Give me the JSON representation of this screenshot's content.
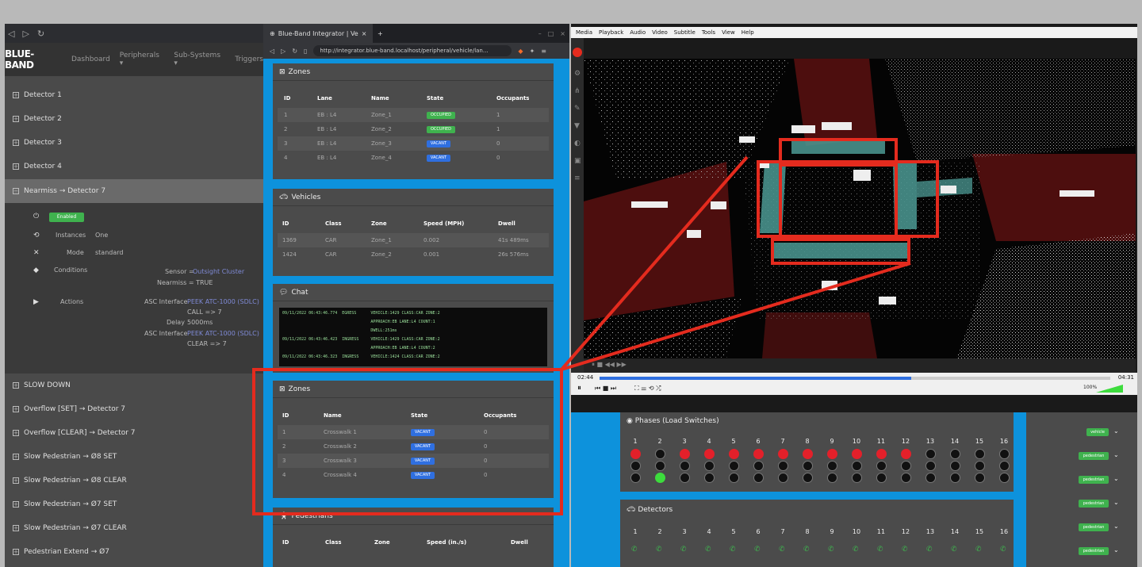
{
  "left": {
    "brand": "BLUE-BAND",
    "nav": [
      "Dashboard",
      "Peripherals ▾",
      "Sub-Systems ▾",
      "Triggers"
    ],
    "detectors_top": [
      "Detector 1",
      "Detector 2",
      "Detector 3",
      "Detector 4"
    ],
    "selected_item": "Nearmiss → Detector 7",
    "detail": {
      "enabled": "Enabled",
      "instances_label": "Instances",
      "instances_value": "One",
      "mode_label": "Mode",
      "mode_value": "standard",
      "conditions_label": "Conditions",
      "sensor_prefix": "Sensor =",
      "sensor_value": "Outsight Cluster",
      "nearmiss": "Nearmiss = TRUE",
      "actions_label": "Actions",
      "asc1_label": "ASC Interface",
      "asc1_value": "PEEK ATC-1000 (SDLC)",
      "call": "CALL => 7",
      "delay_label": "Delay",
      "delay_value": "5000ms",
      "asc2_label": "ASC Interface",
      "asc2_value": "PEEK ATC-1000 (SDLC)",
      "clear": "CLEAR => 7"
    },
    "detectors_bottom": [
      "SLOW DOWN",
      "Overflow [SET] → Detector 7",
      "Overflow [CLEAR] → Detector 7",
      "Slow Pedestrian → Ø8 SET",
      "Slow Pedestrian → Ø8 CLEAR",
      "Slow Pedestrian → Ø7 SET",
      "Slow Pedestrian → Ø7 CLEAR",
      "Pedestrian Extend → Ø7"
    ]
  },
  "mid": {
    "tab_title": "Blue-Band Integrator | Ve",
    "url": "http://integrator.blue-band.localhost/peripheral/vehicle/lan...",
    "zones": {
      "title": "Zones",
      "headers": [
        "ID",
        "Lane",
        "Name",
        "State",
        "Occupants"
      ],
      "rows": [
        [
          "1",
          "EB : L4",
          "Zone_1",
          "OCCUPIED",
          "1"
        ],
        [
          "2",
          "EB : L4",
          "Zone_2",
          "OCCUPIED",
          "1"
        ],
        [
          "3",
          "EB : L4",
          "Zone_3",
          "VACANT",
          "0"
        ],
        [
          "4",
          "EB : L4",
          "Zone_4",
          "VACANT",
          "0"
        ]
      ]
    },
    "vehicles": {
      "title": "Vehicles",
      "headers": [
        "ID",
        "Class",
        "Zone",
        "Speed (MPH)",
        "Dwell"
      ],
      "rows": [
        [
          "1369",
          "CAR",
          "Zone_1",
          "0.002",
          "41s 489ms"
        ],
        [
          "1424",
          "CAR",
          "Zone_2",
          "0.001",
          "26s 576ms"
        ]
      ]
    },
    "chat": {
      "title": "Chat",
      "lines": [
        "09/11/2022 06:43:46.774  EGRESS      VEHICLE:1429 CLASS:CAR ZONE:2",
        "                                     APPROACH:EB LANE:L4 COUNT:1",
        "                                     DWELL:251ms",
        "09/11/2022 06:43:46.423  INGRESS     VEHICLE:1429 CLASS:CAR ZONE:2",
        "                                     APPROACH:EB LANE:L4 COUNT:2",
        "09/11/2022 06:43:46.323  INGRESS     VEHICLE:1424 CLASS:CAR ZONE:2"
      ]
    },
    "crosswalks": {
      "title": "Zones",
      "headers": [
        "ID",
        "Name",
        "State",
        "Occupants"
      ],
      "rows": [
        [
          "1",
          "Crosswalk 1",
          "VACANT",
          "0"
        ],
        [
          "2",
          "Crosswalk 2",
          "VACANT",
          "0"
        ],
        [
          "3",
          "Crosswalk 3",
          "VACANT",
          "0"
        ],
        [
          "4",
          "Crosswalk 4",
          "VACANT",
          "0"
        ]
      ]
    },
    "pedestrians": {
      "title": "Pedestrians",
      "headers": [
        "ID",
        "Class",
        "Zone",
        "Speed (in./s)",
        "Dwell"
      ]
    }
  },
  "right": {
    "menu": [
      "Media",
      "Playback",
      "Audio",
      "Video",
      "Subtitle",
      "Tools",
      "View",
      "Help"
    ],
    "time_left": "02:44",
    "time_right": "04:31",
    "volume": "100%",
    "seek_fraction": 0.61,
    "phases_title": "Phases (Load Switches)",
    "detectors_title": "Detectors",
    "numbers": [
      "1",
      "2",
      "3",
      "4",
      "5",
      "6",
      "7",
      "8",
      "9",
      "10",
      "11",
      "12",
      "13",
      "14",
      "15",
      "16"
    ],
    "phase_red": [
      1,
      0,
      1,
      1,
      1,
      1,
      1,
      1,
      1,
      1,
      1,
      1,
      0,
      0,
      0,
      0
    ],
    "phase_green": [
      0,
      1,
      0,
      0,
      0,
      0,
      0,
      0,
      0,
      0,
      0,
      0,
      0,
      0,
      0,
      0
    ],
    "side_badges": [
      "vehicle",
      "pedestrian",
      "pedestrian",
      "pedestrian",
      "pedestrian",
      "pedestrian"
    ],
    "accent_red": "#e42b1e",
    "accent_green": "#3fb24e",
    "accent_blue": "#0d92dc"
  }
}
